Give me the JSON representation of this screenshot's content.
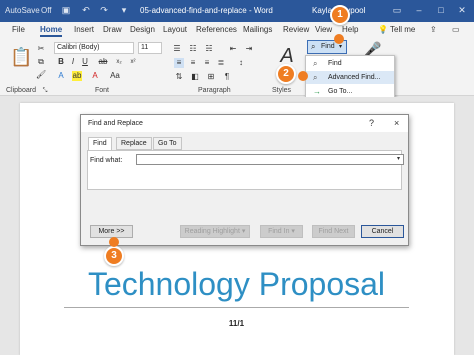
{
  "titlebar": {
    "autosave": "AutoSave",
    "autosave_state": "Off",
    "doc_title": "05-advanced-find-and-replace - Word",
    "user": "Kayla Claypool"
  },
  "tabs": [
    "File",
    "Home",
    "Insert",
    "Draw",
    "Design",
    "Layout",
    "References",
    "Mailings",
    "Review",
    "View",
    "Help",
    "Tell me"
  ],
  "ribbon": {
    "font_name": "Calibri (Body)",
    "font_size": "11",
    "find_label": "Find",
    "groups": {
      "clipboard": "Clipboard",
      "font": "Font",
      "paragraph": "Paragraph",
      "styles": "Styles"
    },
    "paste_label": "Paste"
  },
  "find_menu": {
    "items": [
      "Find",
      "Advanced Find...",
      "Go To..."
    ]
  },
  "dialog": {
    "title": "Find and Replace",
    "help": "?",
    "close": "×",
    "tabs": [
      "Find",
      "Replace",
      "Go To"
    ],
    "find_what_label": "Find what:",
    "find_what_value": "",
    "buttons": {
      "more": "More >>",
      "reading_highlight": "Reading Highlight ▾",
      "find_in": "Find In ▾",
      "find_next": "Find Next",
      "cancel": "Cancel"
    }
  },
  "document": {
    "heading": "Technology Proposal",
    "date": "11/1"
  },
  "badges": [
    "1",
    "2",
    "3"
  ],
  "colors": {
    "accent": "#2b579a",
    "badge": "#ef7d22",
    "heading": "#2e8fc4"
  }
}
